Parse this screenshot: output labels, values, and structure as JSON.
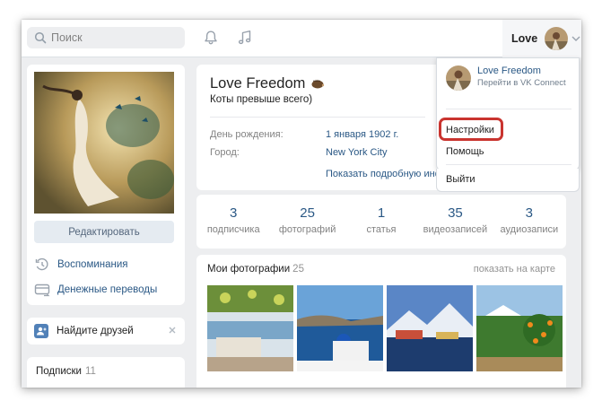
{
  "header": {
    "search_placeholder": "Поиск",
    "user_name": "Love"
  },
  "sidebar": {
    "edit_label": "Редактировать",
    "links": [
      {
        "label": "Воспоминания",
        "icon": "clock-history-icon"
      },
      {
        "label": "Денежные переводы",
        "icon": "money-transfer-icon"
      }
    ],
    "find_friends_label": "Найдите друзей",
    "subscriptions_label": "Подписки",
    "subscriptions_count": "11"
  },
  "profile": {
    "name": "Love Freedom",
    "status": "Коты превыше всего)",
    "birthday_label": "День рождения:",
    "birthday_value": "1 января 1902 г.",
    "city_label": "Город:",
    "city_value": "New York City",
    "show_more": "Показать подробную информацию"
  },
  "counters": [
    {
      "num": "3",
      "label": "подписчика"
    },
    {
      "num": "25",
      "label": "фотографий"
    },
    {
      "num": "1",
      "label": "статья"
    },
    {
      "num": "35",
      "label": "видеозаписей"
    },
    {
      "num": "3",
      "label": "аудиозаписи"
    }
  ],
  "photos": {
    "title": "Мои фотографии",
    "count": "25",
    "map_link": "показать на карте"
  },
  "dropdown": {
    "name": "Love Freedom",
    "connect": "Перейти в VK Connect",
    "settings": "Настройки",
    "help": "Помощь",
    "logout": "Выйти"
  },
  "colors": {
    "accent": "#2a5885",
    "highlight": "#c9342f",
    "background": "#edeef0"
  }
}
